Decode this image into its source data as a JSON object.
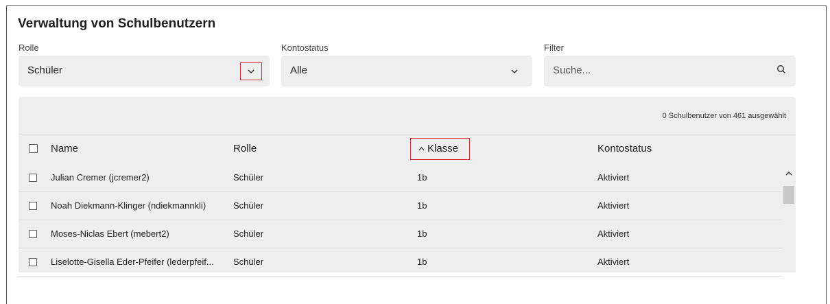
{
  "title": "Verwaltung von Schulbenutzern",
  "filters": {
    "role": {
      "label": "Rolle",
      "value": "Schüler"
    },
    "account_status": {
      "label": "Kontostatus",
      "value": "Alle"
    },
    "filter": {
      "label": "Filter",
      "placeholder": "Suche..."
    }
  },
  "table": {
    "selection_count": "0 Schulbenutzer von 461 ausgewählt",
    "columns": {
      "name": "Name",
      "role": "Rolle",
      "class": "Klasse",
      "status": "Kontostatus"
    },
    "rows": [
      {
        "name": "Julian Cremer (jcremer2)",
        "role": "Schüler",
        "class": "1b",
        "status": "Aktiviert"
      },
      {
        "name": "Noah Diekmann-Klinger (ndiekmannkli)",
        "role": "Schüler",
        "class": "1b",
        "status": "Aktiviert"
      },
      {
        "name": "Moses-Niclas Ebert (mebert2)",
        "role": "Schüler",
        "class": "1b",
        "status": "Aktiviert"
      },
      {
        "name": "Liselotte-Gisella Eder-Pfeifer (lederpfeif...",
        "role": "Schüler",
        "class": "1b",
        "status": "Aktiviert"
      }
    ]
  },
  "colors": {
    "highlight": "#d9252b",
    "panel_bg": "#eeeeee"
  }
}
